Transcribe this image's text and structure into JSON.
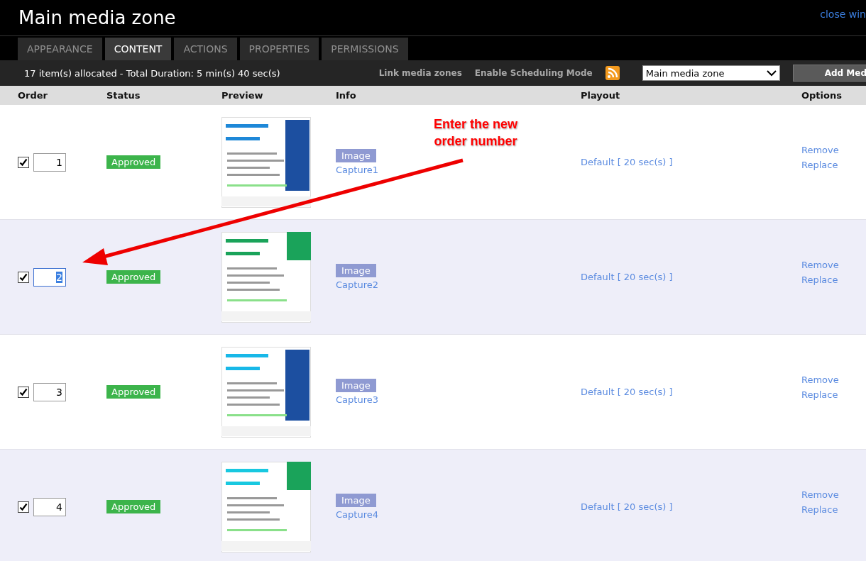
{
  "window": {
    "title": "Main media zone",
    "close_link": "close win"
  },
  "tabs": [
    {
      "label": "APPEARANCE",
      "selected": false
    },
    {
      "label": "CONTENT",
      "selected": true
    },
    {
      "label": "ACTIONS",
      "selected": false
    },
    {
      "label": "PROPERTIES",
      "selected": false
    },
    {
      "label": "PERMISSIONS",
      "selected": false
    }
  ],
  "toolbar": {
    "summary": "17 item(s) allocated - Total Duration: 5 min(s) 40 sec(s)",
    "links": [
      "Link media zones",
      "Enable Scheduling Mode"
    ],
    "zone_select": "Main media zone",
    "add_button": "Add Med"
  },
  "table": {
    "columns": [
      "Order",
      "Status",
      "Preview",
      "Info",
      "Playout",
      "Options"
    ],
    "rows": [
      {
        "checked": true,
        "order": "1",
        "order_highlighted": false,
        "status": "Approved",
        "type": "Image",
        "name": "Capture1",
        "playout": "Default [ 20 sec(s) ]",
        "actions": [
          "Remove",
          "Replace"
        ]
      },
      {
        "checked": true,
        "order": "2",
        "order_highlighted": true,
        "status": "Approved",
        "type": "Image",
        "name": "Capture2",
        "playout": "Default [ 20 sec(s) ]",
        "actions": [
          "Remove",
          "Replace"
        ]
      },
      {
        "checked": true,
        "order": "3",
        "order_highlighted": false,
        "status": "Approved",
        "type": "Image",
        "name": "Capture3",
        "playout": "Default [ 20 sec(s) ]",
        "actions": [
          "Remove",
          "Replace"
        ]
      },
      {
        "checked": true,
        "order": "4",
        "order_highlighted": false,
        "status": "Approved",
        "type": "Image",
        "name": "Capture4",
        "playout": "Default [ 20 sec(s) ]",
        "actions": [
          "Remove",
          "Replace"
        ]
      }
    ]
  },
  "annotation": {
    "text": "Enter the new order number"
  }
}
